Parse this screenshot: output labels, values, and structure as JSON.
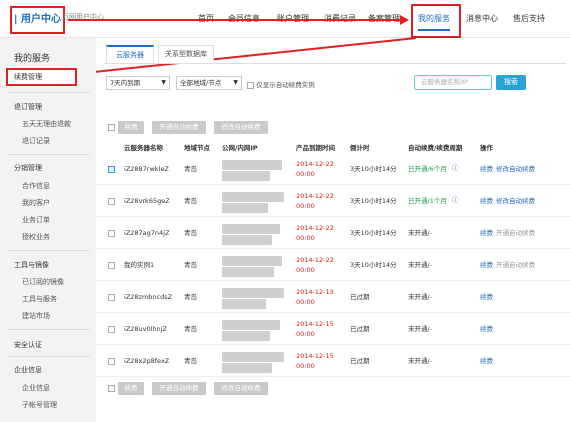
{
  "header": {
    "logo": "| 用户中心",
    "logo_sub": "万网用户中心",
    "nav": [
      "首页",
      "会员信息",
      "账户管理",
      "消费记录",
      "备案管理",
      "我的服务",
      "消息中心",
      "售后支持"
    ]
  },
  "sidebar": {
    "title": "我的服务",
    "active_item": "续费管理",
    "sections": [
      {
        "label": "退订管理",
        "items": [
          "五天无理由退款",
          "退订记录"
        ]
      },
      {
        "label": "分销管理",
        "items": [
          "合作信息",
          "我的客户",
          "业务订单",
          "授权业务"
        ]
      },
      {
        "label": "工具与镜像",
        "items": [
          "已订阅的镜像",
          "工具与服务",
          "建站市场"
        ]
      },
      {
        "label": "安全认证",
        "items": []
      },
      {
        "label": "企业信息",
        "items": [
          "企业信息",
          "子帐号管理"
        ]
      }
    ]
  },
  "tabs": [
    "云服务器",
    "关系型数据库"
  ],
  "filters": {
    "expiry": "7天内到期",
    "region": "全部地域/节点",
    "auto_renew_only_label": "仅显示自动续费实例",
    "search_placeholder": "云服务器名称/IP",
    "search_button": "搜索"
  },
  "batch_buttons": [
    "续费",
    "开通自动续费",
    "修改自动续费"
  ],
  "table": {
    "columns": [
      "云服务器名称",
      "地域节点",
      "公网/内网IP",
      "产品到期时间",
      "倒计时",
      "自动续费/续费周期",
      "操作"
    ],
    "rows": [
      {
        "name": "iZ2887rwkleZ",
        "region": "青岛",
        "date": "2014-12-22",
        "time": "00:00",
        "countdown": "3天10小时14分",
        "auto": "已开通/6个月",
        "auto_on": true,
        "ops": [
          "续费",
          "修改自动续费"
        ],
        "ops_enabled": [
          true,
          true
        ],
        "checked": true
      },
      {
        "name": "iZ28vrk65geZ",
        "region": "青岛",
        "date": "2014-12-22",
        "time": "00:00",
        "countdown": "3天10小时14分",
        "auto": "已开通/1个月",
        "auto_on": true,
        "ops": [
          "续费",
          "修改自动续费"
        ],
        "ops_enabled": [
          true,
          true
        ],
        "checked": false
      },
      {
        "name": "iZ287ag7n4jZ",
        "region": "青岛",
        "date": "2014-12-22",
        "time": "00:00",
        "countdown": "3天10小时14分",
        "auto": "未开通/-",
        "auto_on": false,
        "ops": [
          "续费",
          "开通自动续费"
        ],
        "ops_enabled": [
          true,
          false
        ],
        "checked": false
      },
      {
        "name": "我的实例1",
        "region": "青岛",
        "date": "2014-12-22",
        "time": "00:00",
        "countdown": "3天10小时14分",
        "auto": "未开通/-",
        "auto_on": false,
        "ops": [
          "续费",
          "开通自动续费"
        ],
        "ops_enabled": [
          true,
          false
        ],
        "checked": false
      },
      {
        "name": "iZ28zmbncdsZ",
        "region": "青岛",
        "date": "2014-12-13",
        "time": "00:00",
        "countdown": "已过期",
        "auto": "未开通/-",
        "auto_on": false,
        "ops": [
          "续费"
        ],
        "ops_enabled": [
          true
        ],
        "checked": false
      },
      {
        "name": "iZ28uv0lhnjZ",
        "region": "青岛",
        "date": "2014-12-15",
        "time": "00:00",
        "countdown": "已过期",
        "auto": "未开通/-",
        "auto_on": false,
        "ops": [
          "续费"
        ],
        "ops_enabled": [
          true
        ],
        "checked": false
      },
      {
        "name": "iZ28x2p8fexZ",
        "region": "青岛",
        "date": "2014-12-15",
        "time": "00:00",
        "countdown": "已过期",
        "auto": "未开通/-",
        "auto_on": false,
        "ops": [
          "续费"
        ],
        "ops_enabled": [
          true
        ],
        "checked": false
      }
    ]
  },
  "colors": {
    "accent": "#1b6fc2",
    "annotation": "#e02020",
    "danger": "#e02020",
    "success": "#1a9c4a",
    "disabled": "#c9c9c9"
  }
}
